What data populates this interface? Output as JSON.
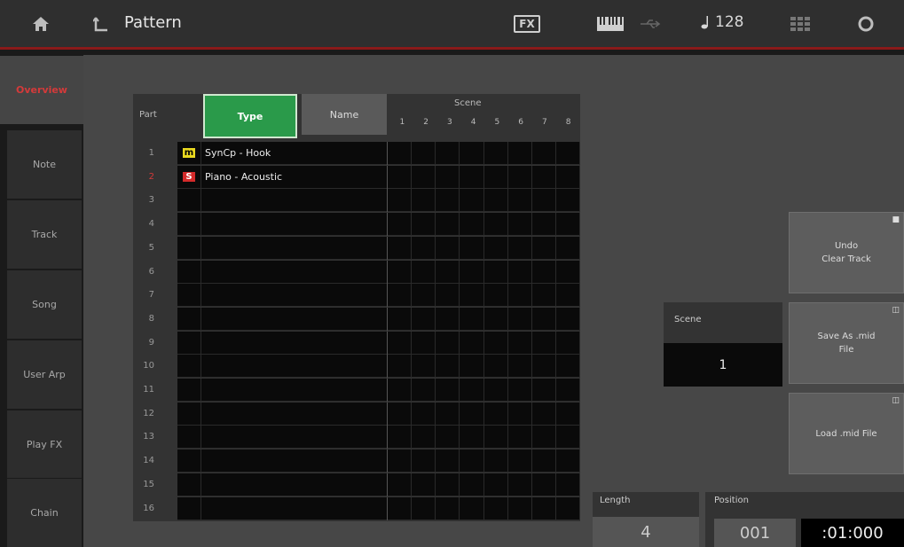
{
  "header": {
    "title": "Pattern",
    "fx_label": "FX",
    "tempo": "128"
  },
  "sidebar": {
    "items": [
      {
        "label": "Overview",
        "active": true
      },
      {
        "label": "Note"
      },
      {
        "label": "Track"
      },
      {
        "label": "Song"
      },
      {
        "label": "User Arp"
      },
      {
        "label": "Play FX"
      },
      {
        "label": "Chain"
      }
    ]
  },
  "table": {
    "part_header": "Part",
    "type_button": "Type",
    "name_button": "Name",
    "scene_header": "Scene",
    "scene_numbers": [
      "1",
      "2",
      "3",
      "4",
      "5",
      "6",
      "7",
      "8"
    ],
    "rows": [
      {
        "num": "1",
        "mark": "m",
        "name": "SynCp - Hook"
      },
      {
        "num": "2",
        "mark": "S",
        "name": "Piano - Acoustic",
        "highlight": true
      },
      {
        "num": "3",
        "mark": "",
        "name": ""
      },
      {
        "num": "4",
        "mark": "",
        "name": ""
      },
      {
        "num": "5",
        "mark": "",
        "name": ""
      },
      {
        "num": "6",
        "mark": "",
        "name": ""
      },
      {
        "num": "7",
        "mark": "",
        "name": ""
      },
      {
        "num": "8",
        "mark": "",
        "name": ""
      },
      {
        "num": "9",
        "mark": "",
        "name": ""
      },
      {
        "num": "10",
        "mark": "",
        "name": ""
      },
      {
        "num": "11",
        "mark": "",
        "name": ""
      },
      {
        "num": "12",
        "mark": "",
        "name": ""
      },
      {
        "num": "13",
        "mark": "",
        "name": ""
      },
      {
        "num": "14",
        "mark": "",
        "name": ""
      },
      {
        "num": "15",
        "mark": "",
        "name": ""
      },
      {
        "num": "16",
        "mark": "",
        "name": ""
      }
    ]
  },
  "actions": {
    "undo_line1": "Undo",
    "undo_line2": "Clear Track",
    "save_line1": "Save As .mid",
    "save_line2": "File",
    "load": "Load .mid File"
  },
  "scene": {
    "label": "Scene",
    "value": "1"
  },
  "length": {
    "label": "Length",
    "value": "4"
  },
  "position": {
    "label": "Position",
    "measure": "001",
    "time": ":01:000"
  },
  "colors": {
    "accent_red": "#d43a3a",
    "type_green": "#2a9a4a",
    "mono_yellow": "#e8d820"
  }
}
